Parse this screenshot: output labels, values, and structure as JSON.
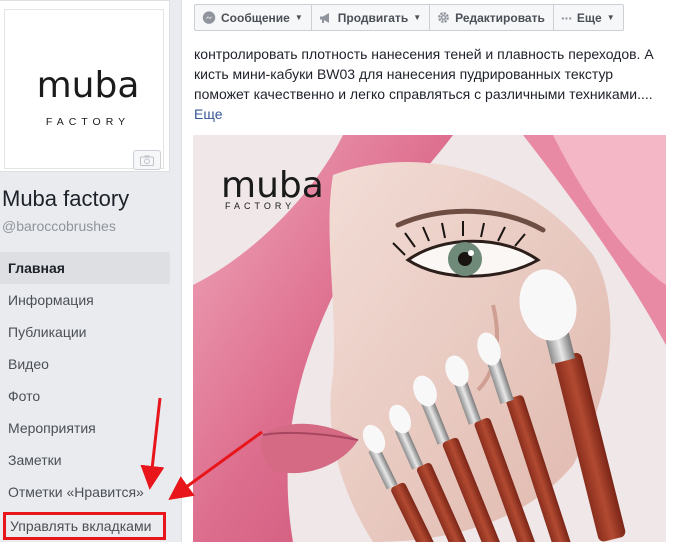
{
  "page": {
    "logo_main": "muba",
    "logo_sub": "FACTORY",
    "name": "Muba factory",
    "handle": "@baroccobrushes"
  },
  "nav": {
    "items": [
      {
        "label": "Главная"
      },
      {
        "label": "Информация"
      },
      {
        "label": "Публикации"
      },
      {
        "label": "Видео"
      },
      {
        "label": "Фото"
      },
      {
        "label": "Мероприятия"
      },
      {
        "label": "Заметки"
      },
      {
        "label": "Отметки «Нравится»"
      }
    ],
    "manage_tabs_label": "Управлять вкладками"
  },
  "toolbar": {
    "message_label": "Сообщение",
    "promote_label": "Продвигать",
    "edit_label": "Редактировать",
    "more_label": "Еще"
  },
  "post": {
    "lines": [
      "контролировать плотность нанесения теней и плавность переходов. А",
      "кисть мини-кабуки BW03 для нанесения пудрированных текстур",
      "поможет качественно и легко справляться с различными техниками...."
    ],
    "see_more_label": "Еще",
    "photo_logo_main": "muba",
    "photo_logo_sub": "FACTORY"
  },
  "colors": {
    "background": "#e9ebee",
    "link": "#365899",
    "highlight": "#e8151b",
    "active_nav": "#dddfe2"
  }
}
